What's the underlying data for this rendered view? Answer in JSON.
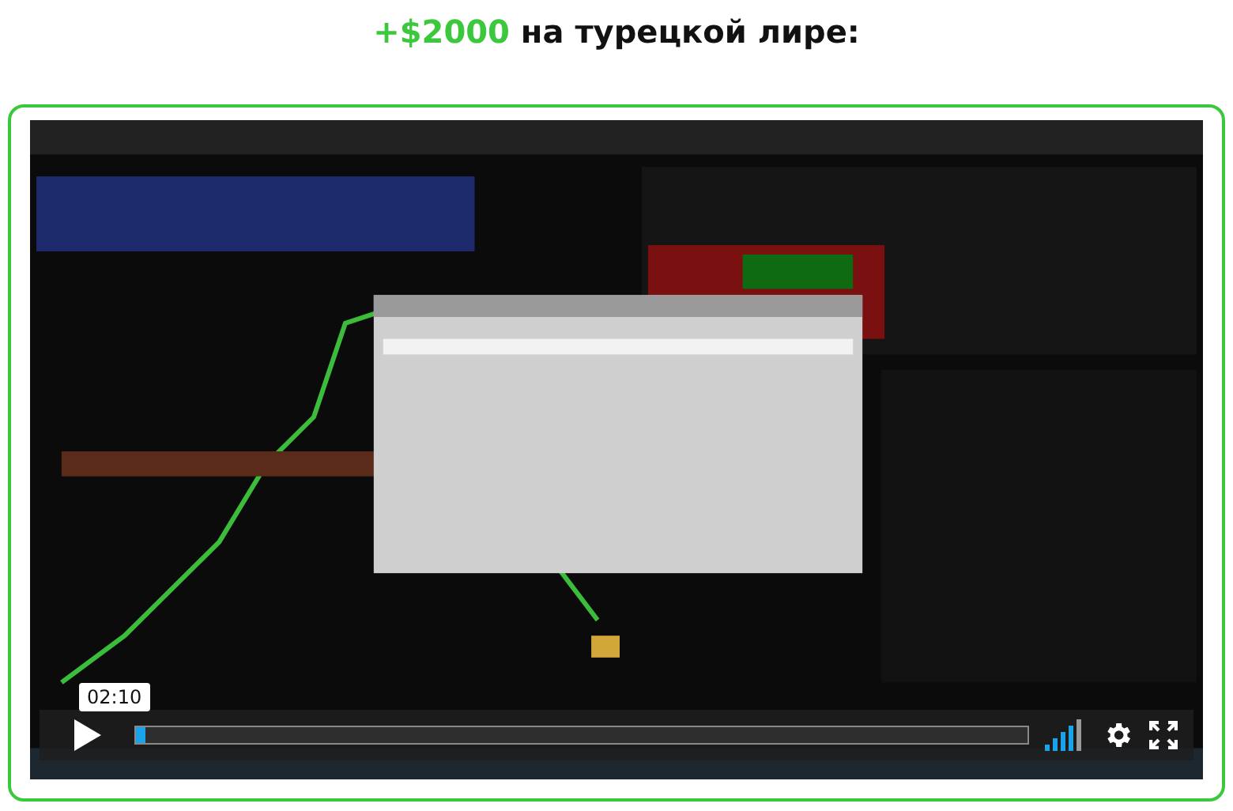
{
  "heading": {
    "text": "**+$2000** на турецкой лире:"
  },
  "video": {
    "kind": "picture",
    "hover_time": "02:10",
    "progress": {
      "level": 0.01
    }
  }
}
